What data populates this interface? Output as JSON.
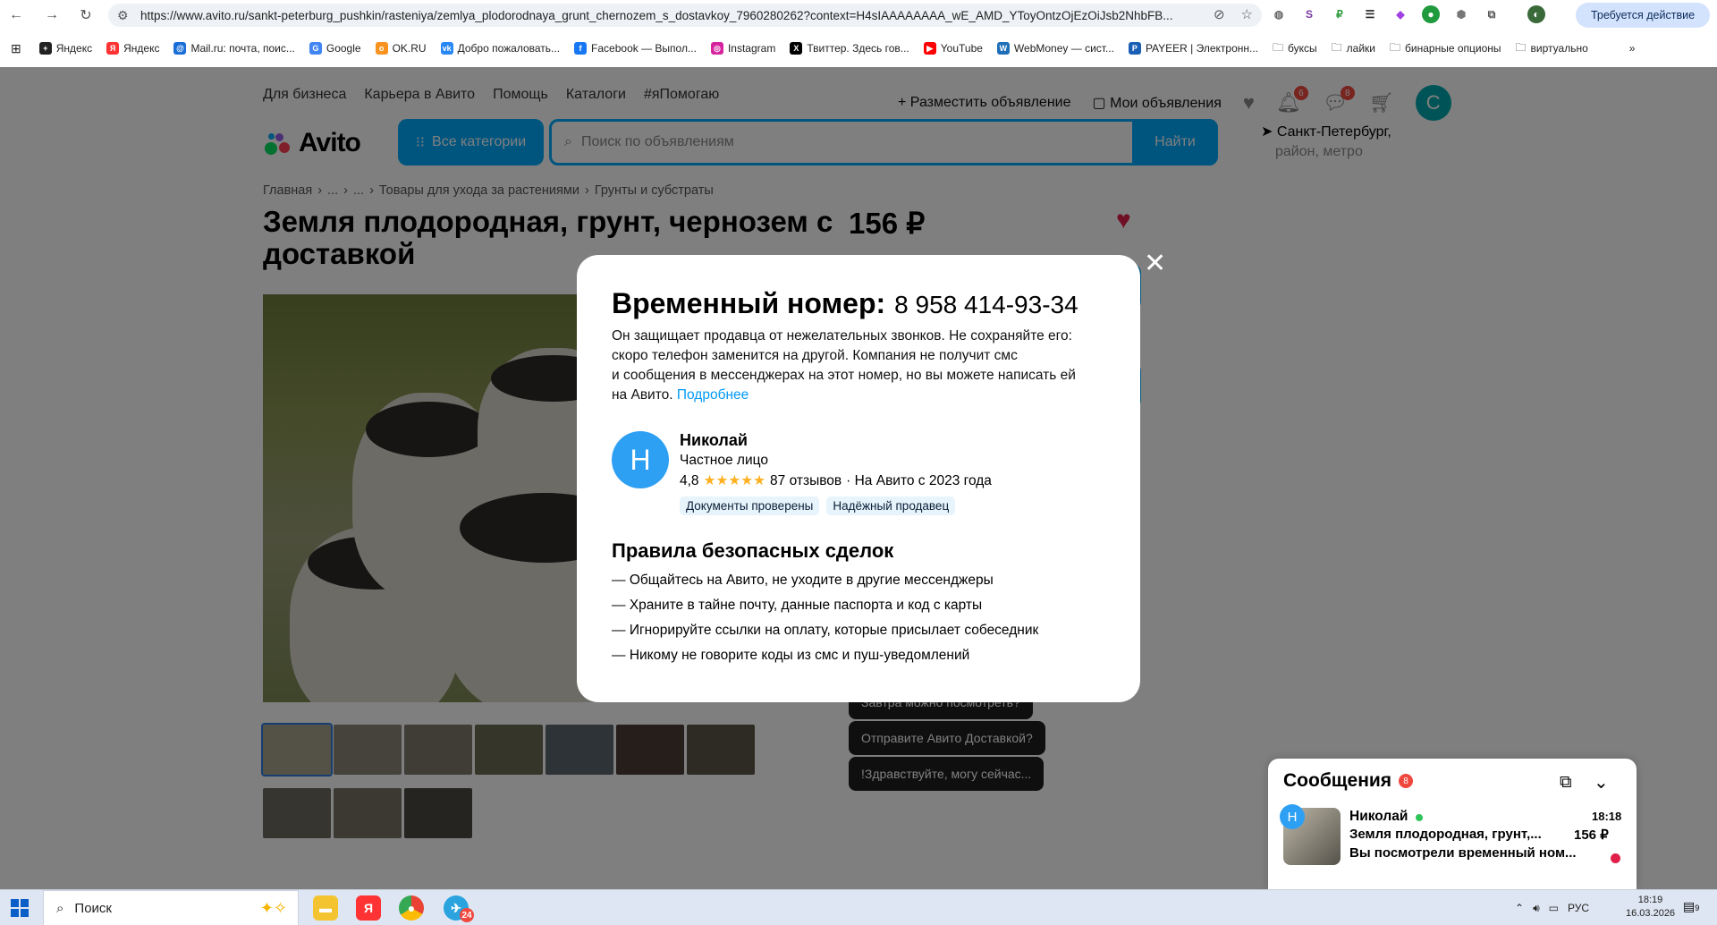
{
  "browser": {
    "url": "https://www.avito.ru/sankt-peterburg_pushkin/rasteniya/zemlya_plodorodnaya_grunt_chernozem_s_dostavkoy_7960280262?context=H4sIAAAAAAAA_wE_AMD_YToyOntzOjEzOiJsb2NhbFB...",
    "action_label": "Требуется действие",
    "bookmarks": [
      "Яндекс",
      "Яндекс",
      "Mail.ru: почта, поис...",
      "Google",
      "OK.RU",
      "Добро пожаловать...",
      "Facebook — Выпол...",
      "Instagram",
      "Твиттер. Здесь гов...",
      "YouTube",
      "WebMoney — сист...",
      "PAYEER | Электронн...",
      "буксы",
      "лайки",
      "бинарные опционы",
      "виртуально"
    ]
  },
  "header": {
    "nav": [
      "Для бизнеса",
      "Карьера в Авито",
      "Помощь",
      "Каталоги",
      "#яПомогаю"
    ],
    "post_ad": "Разместить объявление",
    "my_ads": "Мои объявления",
    "notif_count": "6",
    "msg_count": "8",
    "avatar_letter": "С",
    "logo": "Avito",
    "all_categories": "Все категории",
    "search_placeholder": "Поиск по объявлениям",
    "find": "Найти",
    "city": "Санкт-Петербург,",
    "city_sub": "район, метро"
  },
  "listing": {
    "breadcrumb": [
      "Главная",
      "›",
      "...",
      "›",
      "...",
      "›",
      "Товары для ухода за растениями",
      "›",
      "Грунты и субстраты"
    ],
    "title": "Земля плодородная, грунт, чернозем с доставкой",
    "price": "156 ₽",
    "quick_replies": [
      "Завтра можно посмотреть?",
      "Отправите Авито Доставкой?",
      "!Здравствуйте, могу сейчас..."
    ]
  },
  "modal": {
    "heading": "Временный номер:",
    "number": "8 958 414-93-34",
    "desc_lines": [
      "Он защищает продавца от нежелательных звонков. Не сохраняйте его:",
      "скоро телефон заменится на другой. Компания не получит смс",
      "и сообщения в мессенджерах на этот номер, но вы можете написать ей",
      "на Авито."
    ],
    "more": "Подробнее",
    "seller": {
      "letter": "Н",
      "name": "Николай",
      "type": "Частное лицо",
      "rating": "4,8",
      "stars": "★★★★★",
      "reviews": "87 отзывов",
      "since": "· На Авито с 2023 года",
      "tags": [
        "Документы проверены",
        "Надёжный продавец"
      ]
    },
    "rules_title": "Правила безопасных сделок",
    "rules": [
      "Общайтесь на Авито, не уходите в другие мессенджеры",
      "Храните в тайне почту, данные паспорта и код с карты",
      "Игнорируйте ссылки на оплату, которые присылает собеседник",
      "Никому не говорите коды из смс и пуш-уведомлений"
    ]
  },
  "messages": {
    "title": "Сообщения",
    "badge": "8",
    "name": "Николай",
    "time": "18:18",
    "item": "Земля плодородная, грунт,...",
    "price": "156 ₽",
    "last": "Вы посмотрели временный ном..."
  },
  "taskbar": {
    "search": "Поиск",
    "lang": "РУС",
    "time": "18:19",
    "date": "16.03.2026",
    "notif": "9",
    "tg_badge": "24"
  }
}
